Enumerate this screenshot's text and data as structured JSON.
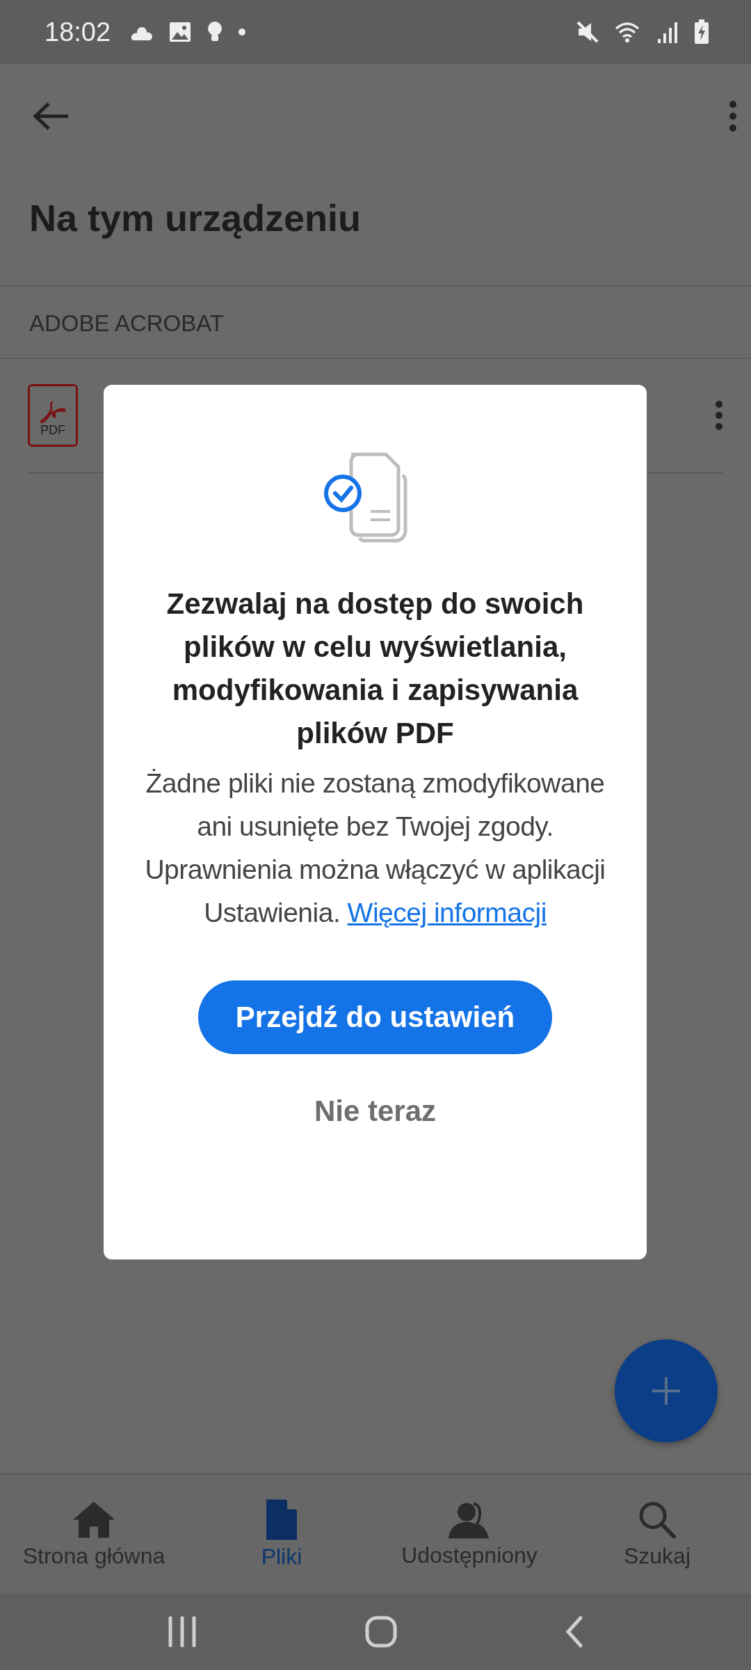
{
  "status_bar": {
    "time": "18:02"
  },
  "app_bar": {
    "title": "Na tym urządzeniu"
  },
  "section": {
    "header": "ADOBE ACROBAT"
  },
  "files": [
    {
      "icon_label": "PDF"
    }
  ],
  "dialog": {
    "title": "Zezwalaj na dostęp do swoich plików w celu wyświetlania, modyfikowania i zapisywania plików PDF",
    "body": "Żadne pliki nie zostaną zmodyfikowane ani usunięte bez Twojej zgody. Uprawnienia można włączyć w aplikacji Ustawienia.",
    "link": "Więcej informacji",
    "primary_button": "Przejdź do ustawień",
    "secondary_button": "Nie teraz"
  },
  "bottom_nav": [
    {
      "label": "Strona główna",
      "kind": "home",
      "selected": false
    },
    {
      "label": "Pliki",
      "kind": "file",
      "selected": true
    },
    {
      "label": "Udostępniony",
      "kind": "people",
      "selected": false
    },
    {
      "label": "Szukaj",
      "kind": "search",
      "selected": false
    }
  ]
}
